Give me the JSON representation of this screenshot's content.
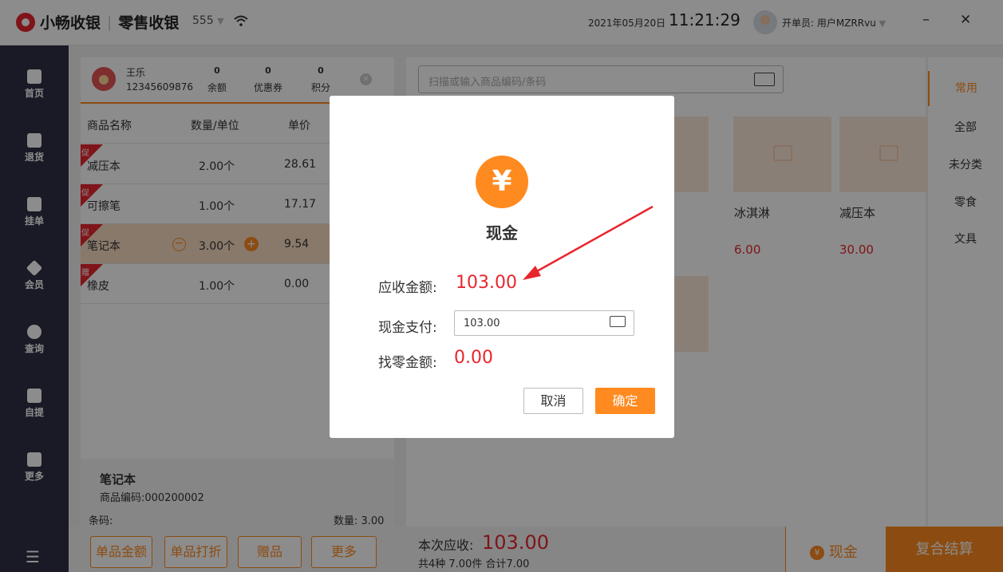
{
  "app": {
    "brand": "小畅收银",
    "mode": "零售收银",
    "store": "555",
    "date": "2021年05月20日",
    "time": "11:21:29",
    "operator": "开单员: 用户MZRRvu"
  },
  "sidebar": {
    "items": [
      {
        "label": "首页"
      },
      {
        "label": "退货"
      },
      {
        "label": "挂单"
      },
      {
        "label": "会员"
      },
      {
        "label": "查询"
      },
      {
        "label": "自提"
      },
      {
        "label": "更多"
      }
    ]
  },
  "member": {
    "name": "王乐",
    "phone": "12345609876",
    "balance": {
      "value": "0",
      "label": "余额"
    },
    "coupons": {
      "value": "0",
      "label": "优惠券"
    },
    "points": {
      "value": "0",
      "label": "积分"
    }
  },
  "cart": {
    "headers": {
      "name": "商品名称",
      "qty": "数量/单位",
      "price": "单价"
    },
    "rows": [
      {
        "tag": "促",
        "name": "减压本",
        "qty": "2.00个",
        "price": "28.61"
      },
      {
        "tag": "促",
        "name": "可擦笔",
        "qty": "1.00个",
        "price": "17.17"
      },
      {
        "tag": "促",
        "name": "笔记本",
        "qty": "3.00个",
        "price": "9.54"
      },
      {
        "tag": "赠",
        "name": "橡皮",
        "qty": "1.00个",
        "price": "0.00"
      }
    ],
    "detail": {
      "name": "笔记本",
      "code": "商品编码:000200002",
      "barcode": "条码:",
      "qty": "数量: 3.00"
    }
  },
  "bottom": {
    "btn1": "单品金额",
    "btn2": "单品打折",
    "btn3": "赠品",
    "btn4": "更多",
    "due_label": "本次应收:",
    "due_value": "103.00",
    "summary": "共4种 7.00件 合计7.00",
    "cash": "现金",
    "combo": "复合结算"
  },
  "products": {
    "search_placeholder": "扫描或输入商品编码/条码",
    "items": [
      {
        "name": "冰淇淋",
        "price": "6.00"
      },
      {
        "name": "减压本",
        "price": "30.00"
      }
    ]
  },
  "categories": [
    "常用",
    "全部",
    "未分类",
    "零食",
    "文具"
  ],
  "dialog": {
    "icon": "¥",
    "title": "现金",
    "due_label": "应收金额:",
    "due_value": "103.00",
    "pay_label": "现金支付:",
    "pay_value": "103.00",
    "change_label": "找零金额:",
    "change_value": "0.00",
    "cancel": "取消",
    "ok": "确定"
  }
}
